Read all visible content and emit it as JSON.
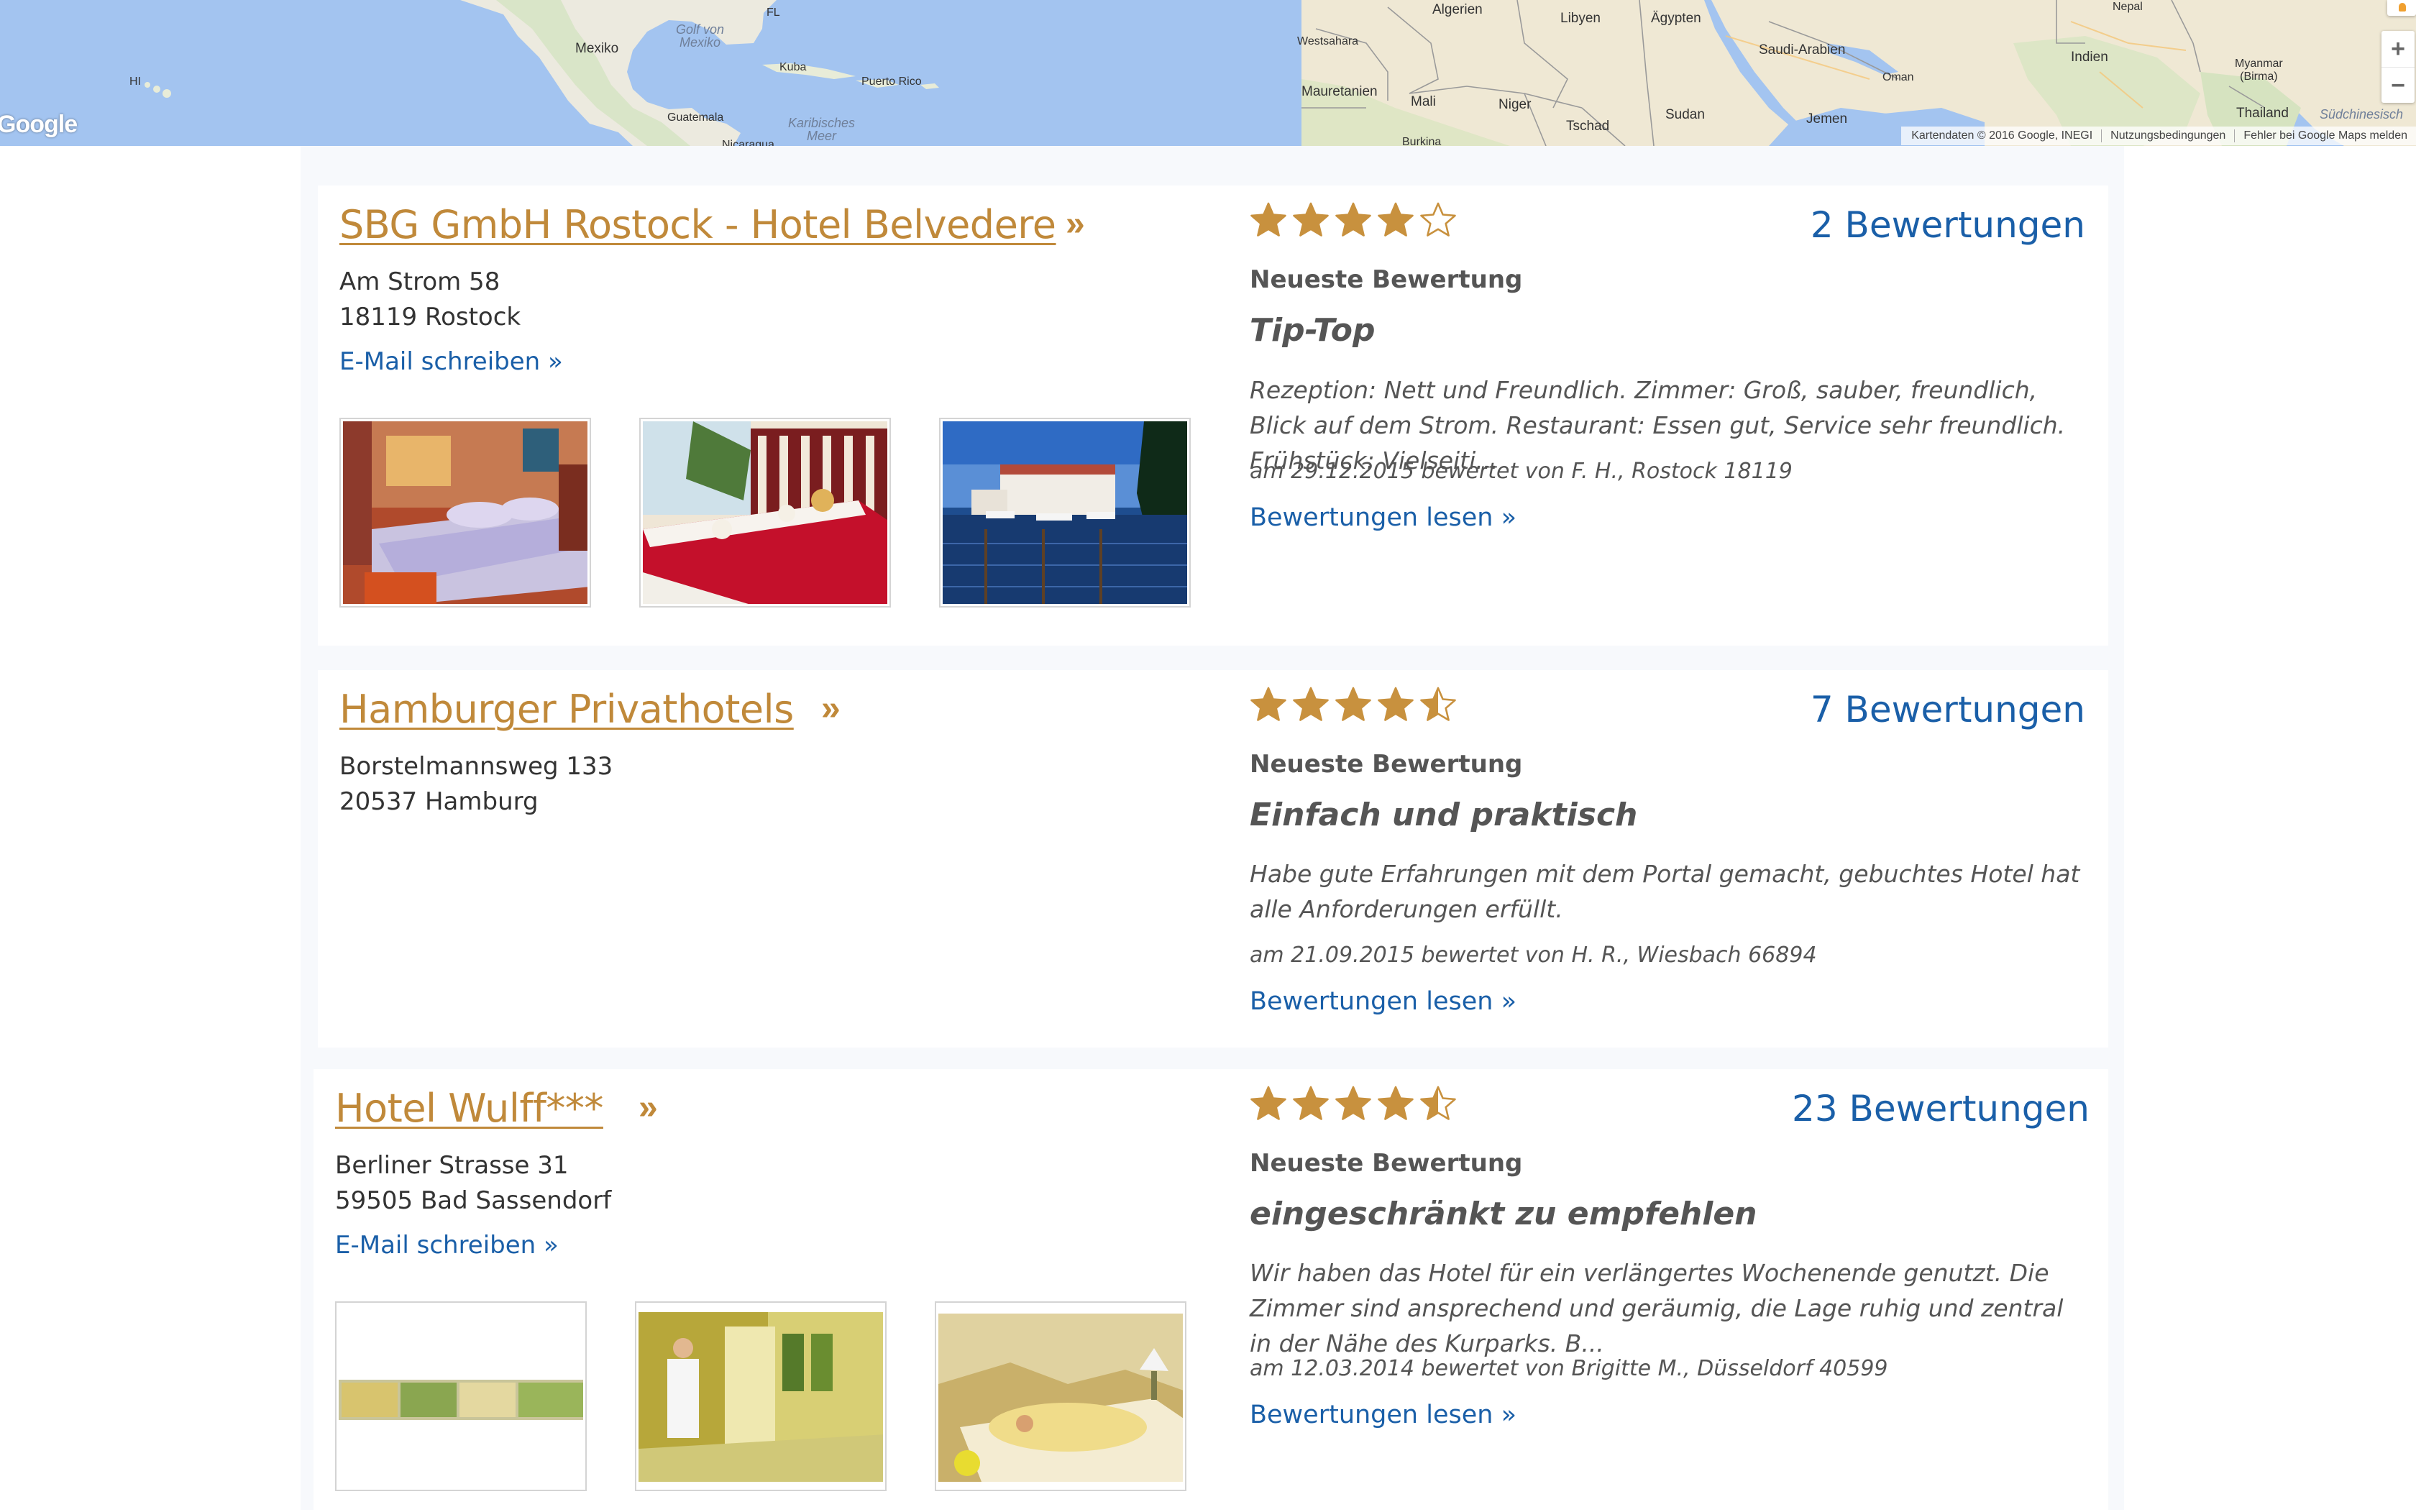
{
  "map": {
    "labels": {
      "algerien": "Algerien",
      "libyen": "Libyen",
      "aegypten": "Ägypten",
      "nepal": "Nepal",
      "westsahara": "Westsahara",
      "saudi": "Saudi-Arabien",
      "oman": "Oman",
      "indien": "Indien",
      "myanmar": "Myanmar\n(Birma)",
      "mauretanien": "Mauretanien",
      "mali": "Mali",
      "niger": "Niger",
      "tschad": "Tschad",
      "sudan": "Sudan",
      "jemen": "Jemen",
      "thailand": "Thailand",
      "suedchin": "Südchinesisch",
      "burkina": "Burkina",
      "mexiko": "Mexiko",
      "golf": "Golf von\nMexiko",
      "fl": "FL",
      "kuba": "Kuba",
      "puerto": "Puerto Rico",
      "hi": "HI",
      "guatemala": "Guatemala",
      "karibik": "Karibisches\nMeer",
      "nicaragua": "Nicaragua"
    },
    "google_logo": "Google",
    "attribution": {
      "data": "Kartendaten © 2016 Google, INEGI",
      "terms": "Nutzungsbedingungen",
      "report": "Fehler bei Google Maps melden"
    },
    "zoom_in": "+",
    "zoom_out": "−"
  },
  "hotels": [
    {
      "name": "SBG GmbH Rostock - Hotel Belvedere",
      "arrow": "»",
      "street": "Am Strom 58",
      "city": "18119 Rostock",
      "email_link": "E-Mail schreiben »",
      "rating": 4,
      "count": "2 Bewertungen",
      "latest_label": "Neueste Bewertung",
      "review_title": "Tip-Top",
      "review_text": "Rezeption: Nett und Freundlich. Zimmer: Groß, sauber, freundlich, Blick auf dem Strom. Restaurant: Essen gut, Service sehr freundlich. Frühstück: Vielseiti...",
      "review_meta": "am 29.12.2015 bewertet von F. H., Rostock 18119",
      "read_link": "Bewertungen lesen »"
    },
    {
      "name": "Hamburger Privathotels",
      "arrow": "»",
      "street": "Borstelmannsweg 133",
      "city": "20537 Hamburg",
      "rating": 4.5,
      "count": "7 Bewertungen",
      "latest_label": "Neueste Bewertung",
      "review_title": "Einfach und praktisch",
      "review_text": "Habe gute Erfahrungen mit dem Portal gemacht, gebuchtes Hotel hat alle Anforderungen erfüllt.",
      "review_meta": "am 21.09.2015 bewertet von H. R., Wiesbach 66894",
      "read_link": "Bewertungen lesen »"
    },
    {
      "name": "Hotel Wulff***",
      "arrow": "»",
      "street": "Berliner Strasse 31",
      "city": "59505 Bad Sassendorf",
      "email_link": "E-Mail schreiben »",
      "rating": 4.5,
      "count": "23 Bewertungen",
      "latest_label": "Neueste Bewertung",
      "review_title": "eingeschränkt zu empfehlen",
      "review_text": "Wir haben das Hotel für ein verlängertes Wochenende genutzt. Die Zimmer sind ansprechend und geräumig, die Lage ruhig und zentral in der Nähe des Kurparks. B...",
      "review_meta": "am 12.03.2014 bewertet von Brigitte M., Düsseldorf 40599",
      "read_link": "Bewertungen lesen »"
    }
  ],
  "colors": {
    "title": "#c0893a",
    "link": "#1a5fa8",
    "star": "#c8913e"
  }
}
